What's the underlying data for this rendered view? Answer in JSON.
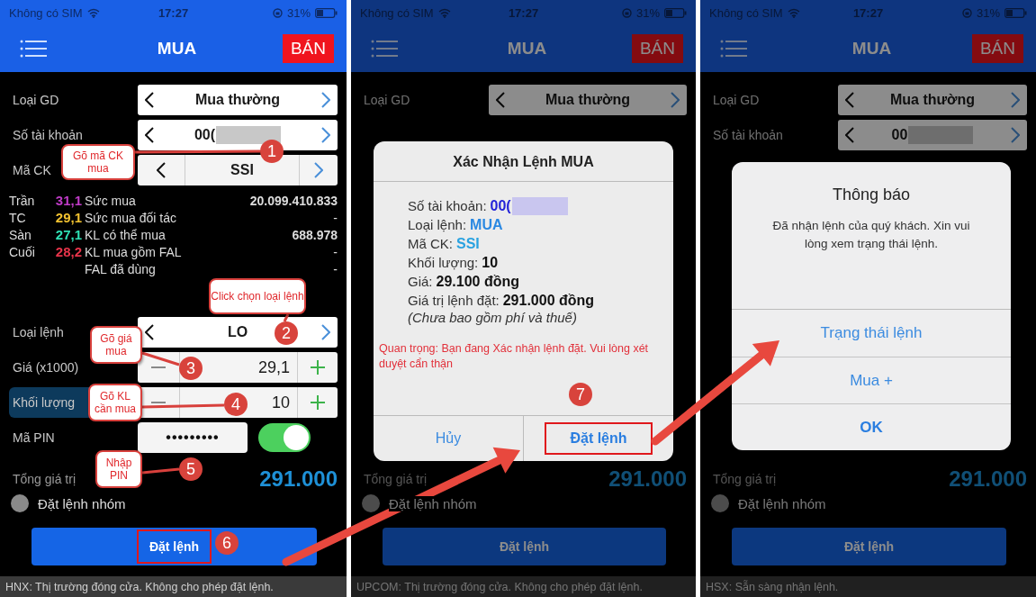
{
  "phones": [
    {
      "dimmed": false,
      "status_bar": {
        "carrier": "Không có SIM",
        "time": "17:27",
        "battery": "31%"
      },
      "header": {
        "title": "MUA",
        "sell_button": "BÁN"
      },
      "rows": [
        {
          "kind": "picker",
          "label": "Loại GD",
          "value": "Mua thường",
          "masked": false
        },
        {
          "kind": "picker",
          "label": "Số tài khoản",
          "value": "00(",
          "masked": true
        },
        {
          "kind": "segmented",
          "label": "Mã CK",
          "value": "SSI",
          "masked": false
        }
      ],
      "stats": [
        {
          "label": "Trần",
          "price": "31,1",
          "color": "#c03cc8",
          "metric": "Sức mua",
          "value": "20.099.410.833"
        },
        {
          "label": "TC",
          "price": "29,1",
          "color": "#f2c230",
          "metric": "Sức mua đối tác",
          "value": "-"
        },
        {
          "label": "Sàn",
          "price": "27,1",
          "color": "#2fe0b4",
          "metric": "KL có thể mua",
          "value": "688.978"
        },
        {
          "label": "Cuối",
          "price": "28,2",
          "color": "#e8344a",
          "metric": "KL mua gồm FAL",
          "value": "-"
        },
        {
          "metric": "FAL đã dùng",
          "value": "-"
        }
      ],
      "order_rows": [
        {
          "kind": "picker",
          "label": "Loại lệnh",
          "value": "LO",
          "highlighted": false
        },
        {
          "kind": "stepper",
          "label": "Giá (x1000)",
          "value": "29,1",
          "highlighted": false
        },
        {
          "kind": "stepper",
          "label": "Khối lượng",
          "value": "10",
          "highlighted": true
        },
        {
          "kind": "pin",
          "label": "Mã PIN",
          "value": "•••••••••",
          "on": true,
          "highlighted": false
        }
      ],
      "total": {
        "label": "Tổng giá trị",
        "value": "291.000"
      },
      "group_order": {
        "label": "Đặt lệnh nhóm",
        "checked": false
      },
      "submit_button": {
        "label": "Đặt lệnh",
        "framed": true
      },
      "market_status": "HNX: Thị trường đóng cửa. Không cho phép đặt lệnh."
    },
    {
      "dimmed": true,
      "status_bar": {
        "carrier": "Không có SIM",
        "time": "17:27",
        "battery": "31%"
      },
      "header": {
        "title": "MUA",
        "sell_button": "BÁN"
      },
      "rows": [
        {
          "kind": "picker",
          "label": "Loại GD",
          "value": "Mua thường",
          "masked": false
        }
      ],
      "total": {
        "label": "Tổng giá trị",
        "value": "291.000"
      },
      "group_order": {
        "label": "Đặt lệnh nhóm",
        "checked": false
      },
      "submit_button": {
        "label": "Đặt lệnh",
        "framed": false
      },
      "market_status": "UPCOM: Thị trường đóng cửa. Không cho phép đặt lệnh.",
      "dialog": {
        "kind": "confirm",
        "title": "Xác Nhận Lệnh MUA",
        "lines": [
          {
            "label": "Số tài khoản:",
            "value": "00(",
            "color": "#2323d8",
            "masked": true
          },
          {
            "label": "Loại lệnh:",
            "value": "MUA",
            "color": "#2a88e2",
            "masked": false
          },
          {
            "label": "Mã CK:",
            "value": "SSI",
            "color": "#2aa2e0",
            "masked": false
          },
          {
            "label": "Khối lượng:",
            "value": "10",
            "color": "#111111",
            "masked": false
          },
          {
            "label": "Giá:",
            "value": "29.100 đồng",
            "color": "#111111",
            "masked": false
          },
          {
            "label": "Giá trị lệnh đặt:",
            "value": "291.000 đồng",
            "color": "#111111",
            "masked": false
          }
        ],
        "note": "(Chưa bao gồm phí và thuế)",
        "warning": "Quan trọng: Bạn đang Xác nhận lệnh đặt. Vui lòng xét duyệt cẩn thận",
        "actions": [
          {
            "label": "Hủy",
            "primary": false,
            "framed": false
          },
          {
            "label": "Đặt lệnh",
            "primary": true,
            "framed": true
          }
        ]
      }
    },
    {
      "dimmed": true,
      "status_bar": {
        "carrier": "Không có SIM",
        "time": "17:27",
        "battery": "31%"
      },
      "header": {
        "title": "MUA",
        "sell_button": "BÁN"
      },
      "rows": [
        {
          "kind": "picker",
          "label": "Loại GD",
          "value": "Mua thường",
          "masked": false
        },
        {
          "kind": "picker",
          "label": "Số tài khoản",
          "value": "00",
          "masked": true
        }
      ],
      "total": {
        "label": "Tổng giá trị",
        "value": "291.000"
      },
      "group_order": {
        "label": "Đặt lệnh nhóm",
        "checked": false
      },
      "submit_button": {
        "label": "Đặt lệnh",
        "framed": false
      },
      "market_status": "HSX: Sẵn sàng nhận lệnh.",
      "dialog": {
        "kind": "alert",
        "title": "Thông báo",
        "message": "Đã nhận lệnh của quý khách. Xin vui lòng xem trạng thái lệnh.",
        "actions": [
          {
            "label": "Trạng thái lệnh",
            "primary": false,
            "framed": false
          },
          {
            "label": "Mua +",
            "primary": false,
            "framed": false
          },
          {
            "label": "OK",
            "primary": true,
            "framed": false
          }
        ]
      }
    }
  ],
  "annotations": {
    "callouts": [
      "Gõ mã CK mua",
      "Click chọn loại lệnh",
      "Gõ giá mua",
      "Gõ KL cần mua",
      "Nhập PIN"
    ],
    "steps": [
      "1",
      "2",
      "3",
      "4",
      "5",
      "6",
      "7"
    ]
  }
}
